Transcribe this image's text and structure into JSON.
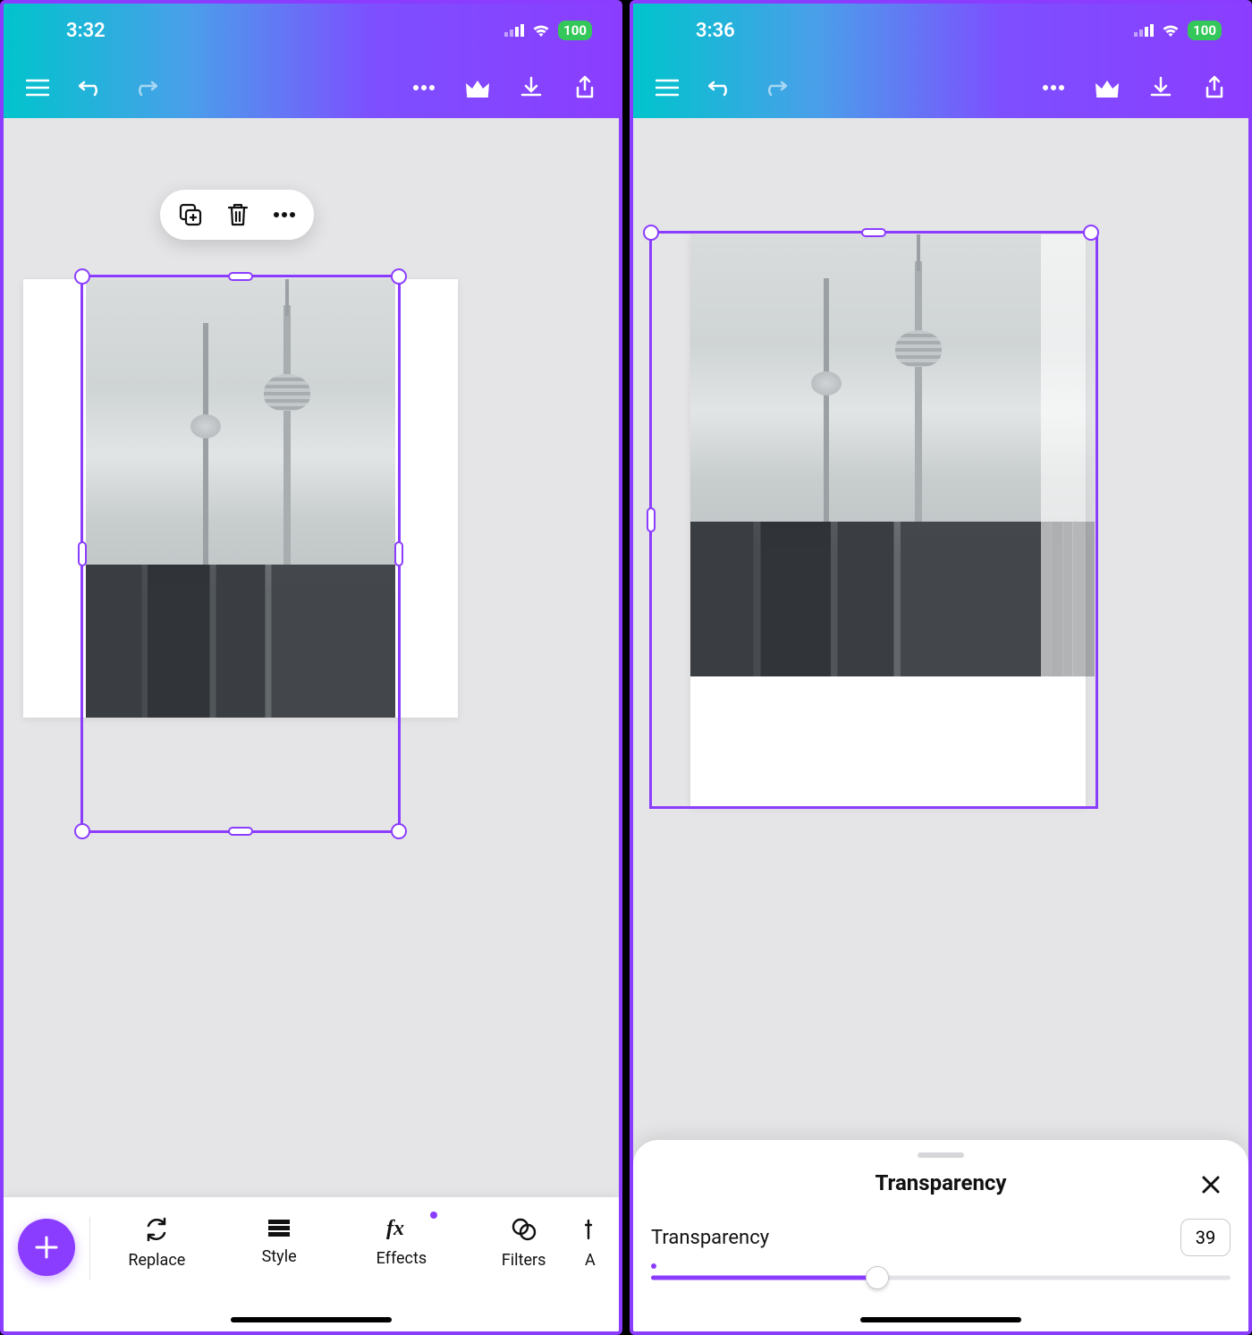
{
  "left": {
    "status": {
      "time": "3:32",
      "battery": "100"
    },
    "context": {
      "duplicate_icon": "duplicate",
      "delete_icon": "trash",
      "more_icon": "more"
    },
    "toolbar": {
      "items": [
        {
          "label": "Replace",
          "icon": "replace"
        },
        {
          "label": "Style",
          "icon": "style"
        },
        {
          "label": "Effects",
          "icon": "fx",
          "dot": true
        },
        {
          "label": "Filters",
          "icon": "filters"
        },
        {
          "label": "A",
          "icon": "adjust_partial"
        }
      ]
    }
  },
  "right": {
    "status": {
      "time": "3:36",
      "battery": "100"
    },
    "sheet": {
      "title": "Transparency",
      "label": "Transparency",
      "value": "39",
      "percent": 39
    }
  },
  "appbar_icons": {
    "menu": "menu",
    "undo": "undo",
    "redo": "redo",
    "more": "more",
    "crown": "crown",
    "download": "download",
    "share": "share"
  }
}
